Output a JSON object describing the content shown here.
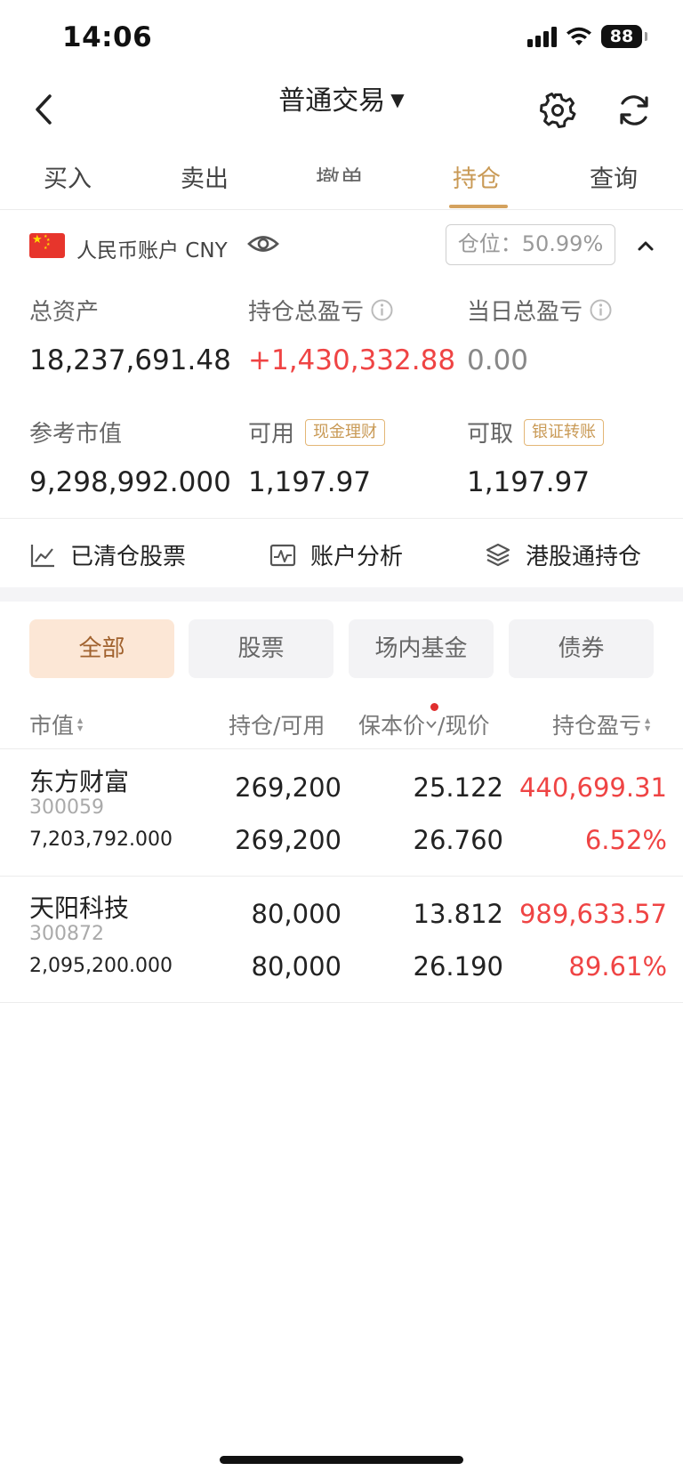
{
  "status": {
    "time": "14:06",
    "battery": "88"
  },
  "nav": {
    "title": "普通交易",
    "title_arrow": "▼"
  },
  "tabs": [
    {
      "label": "买入"
    },
    {
      "label": "卖出"
    },
    {
      "label": "撤单"
    },
    {
      "label": "持仓"
    },
    {
      "label": "查询"
    }
  ],
  "account": {
    "name": "人民币账户 CNY",
    "position_label": "仓位：",
    "position_value": "50.99%"
  },
  "stats": {
    "total_assets_label": "总资产",
    "total_assets_value": "18,237,691.48",
    "holding_pl_label": "持仓总盈亏",
    "holding_pl_value": "+1,430,332.88",
    "daily_pl_label": "当日总盈亏",
    "daily_pl_value": "0.00",
    "market_value_label": "参考市值",
    "market_value_value": "9,298,992.000",
    "available_label": "可用",
    "available_tag": "现金理财",
    "available_value": "1,197.97",
    "withdrawable_label": "可取",
    "withdrawable_tag": "银证转账",
    "withdrawable_value": "1,197.97"
  },
  "tools": [
    {
      "label": "已清仓股票",
      "icon": "chart-line-icon"
    },
    {
      "label": "账户分析",
      "icon": "pulse-icon"
    },
    {
      "label": "港股通持仓",
      "icon": "layers-icon"
    }
  ],
  "filters": [
    {
      "label": "全部"
    },
    {
      "label": "股票"
    },
    {
      "label": "场内基金"
    },
    {
      "label": "债券"
    }
  ],
  "columns": {
    "market_value": "市值",
    "holding": "持仓/可用",
    "price": "保本价",
    "price_suffix": "/现价",
    "pl": "持仓盈亏"
  },
  "holdings": [
    {
      "name": "东方财富",
      "code": "300059",
      "market_value": "7,203,792.000",
      "holding": "269,200",
      "available": "269,200",
      "breakeven": "25.122",
      "current": "26.760",
      "pl": "440,699.31",
      "pl_pct": "6.52%"
    },
    {
      "name": "天阳科技",
      "code": "300872",
      "market_value": "2,095,200.000",
      "holding": "80,000",
      "available": "80,000",
      "breakeven": "13.812",
      "current": "26.190",
      "pl": "989,633.57",
      "pl_pct": "89.61%"
    }
  ],
  "colors": {
    "accent": "#c99a56",
    "up_red": "#ef4444",
    "chip_active_bg": "#fce7d6"
  }
}
